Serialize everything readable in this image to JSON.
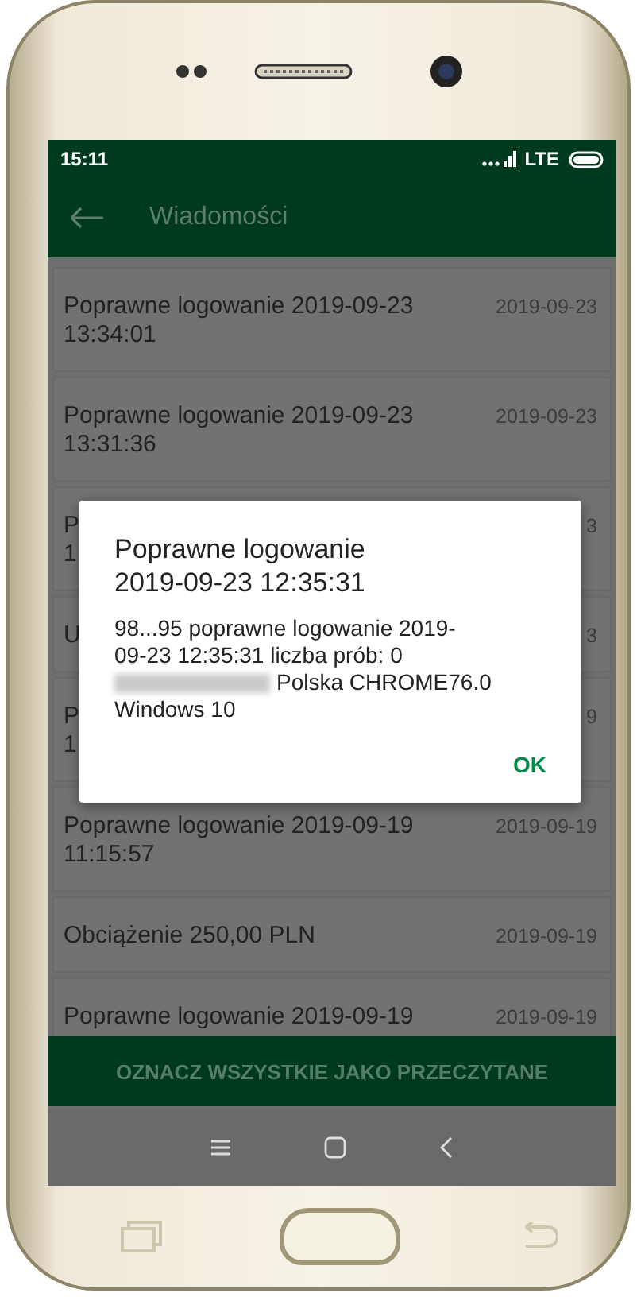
{
  "status_bar": {
    "time": "15:11",
    "network": "LTE"
  },
  "header": {
    "title": "Wiadomości"
  },
  "messages": [
    {
      "lines": [
        "Poprawne logowanie 2019-09-23",
        "13:34:01"
      ],
      "date": "2019-09-23"
    },
    {
      "lines": [
        "Poprawne logowanie 2019-09-23",
        "13:31:36"
      ],
      "date": "2019-09-23"
    },
    {
      "lines": [
        "P",
        "1"
      ],
      "date": "3"
    },
    {
      "lines": [
        "U"
      ],
      "date": "3"
    },
    {
      "lines": [
        "P",
        "1"
      ],
      "date": "9"
    },
    {
      "lines": [
        "Poprawne logowanie 2019-09-19",
        "11:15:57"
      ],
      "date": "2019-09-19"
    },
    {
      "lines": [
        "Obciążenie 250,00 PLN"
      ],
      "date": "2019-09-19"
    },
    {
      "lines": [
        "Poprawne logowanie 2019-09-19"
      ],
      "date": "2019-09-19"
    }
  ],
  "dialog": {
    "title": "Poprawne logowanie 2019-09-23 12:35:31",
    "body": "98...95 poprawne logowanie 2019-09-23 12:35:31 liczba prób: 0",
    "body_after_redaction": "Polska CHROME76.0",
    "body_last_line": "Windows 10",
    "button": "OK"
  },
  "mark_all_button": "OZNACZ WSZYSTKIE JAKO PRZECZYTANE"
}
